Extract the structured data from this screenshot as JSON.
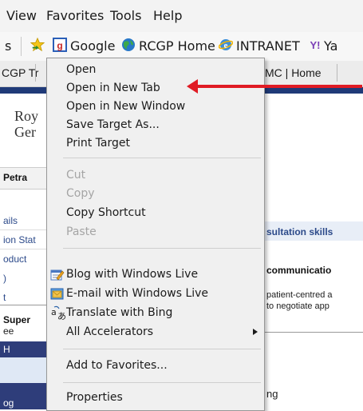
{
  "menubar": {
    "items": [
      "View",
      "Favorites",
      "Tools",
      "Help"
    ]
  },
  "favorites_bar": {
    "partial_left": "s",
    "items": [
      {
        "label": "Google",
        "icon": "google-icon"
      },
      {
        "label": "RCGP Home",
        "icon": "globe-icon"
      },
      {
        "label": "INTRANET",
        "icon": "ie-icon"
      },
      {
        "label": "Ya",
        "icon": "yahoo-icon"
      }
    ]
  },
  "tabs": {
    "left_partial": "CGP Tr",
    "right_partial": "MC | Home"
  },
  "page": {
    "roy": "Roy",
    "ger": "Ger",
    "petra": "Petra",
    "ails": "ails",
    "ion_sta": "ion Stat",
    "oduct": "oduct",
    "paren": ")",
    "t": "t",
    "super": "Super",
    "ee": "ee",
    "h": "H",
    "log": "og",
    "sultation": "sultation skills",
    "communication": "communicatio",
    "patient": "patient-centred a",
    "negotiate": "to negotiate app",
    "ng": "ng"
  },
  "context_menu": {
    "items": [
      {
        "label": "Open",
        "enabled": true
      },
      {
        "label": "Open in New Tab",
        "enabled": true
      },
      {
        "label": "Open in New Window",
        "enabled": true
      },
      {
        "label": "Save Target As...",
        "enabled": true
      },
      {
        "label": "Print Target",
        "enabled": true
      },
      {
        "label": "Cut",
        "enabled": false
      },
      {
        "label": "Copy",
        "enabled": false
      },
      {
        "label": "Copy Shortcut",
        "enabled": true
      },
      {
        "label": "Paste",
        "enabled": false
      },
      {
        "label": "Blog with Windows Live",
        "enabled": true,
        "icon": "blog-icon"
      },
      {
        "label": "E-mail with Windows Live",
        "enabled": true,
        "icon": "email-icon"
      },
      {
        "label": "Translate with Bing",
        "enabled": true,
        "icon": "translate-icon"
      },
      {
        "label": "All Accelerators",
        "enabled": true,
        "submenu": true
      },
      {
        "label": "Add to Favorites...",
        "enabled": true
      },
      {
        "label": "Properties",
        "enabled": true
      }
    ]
  },
  "annotation": {
    "arrow_color": "#e01b24"
  }
}
